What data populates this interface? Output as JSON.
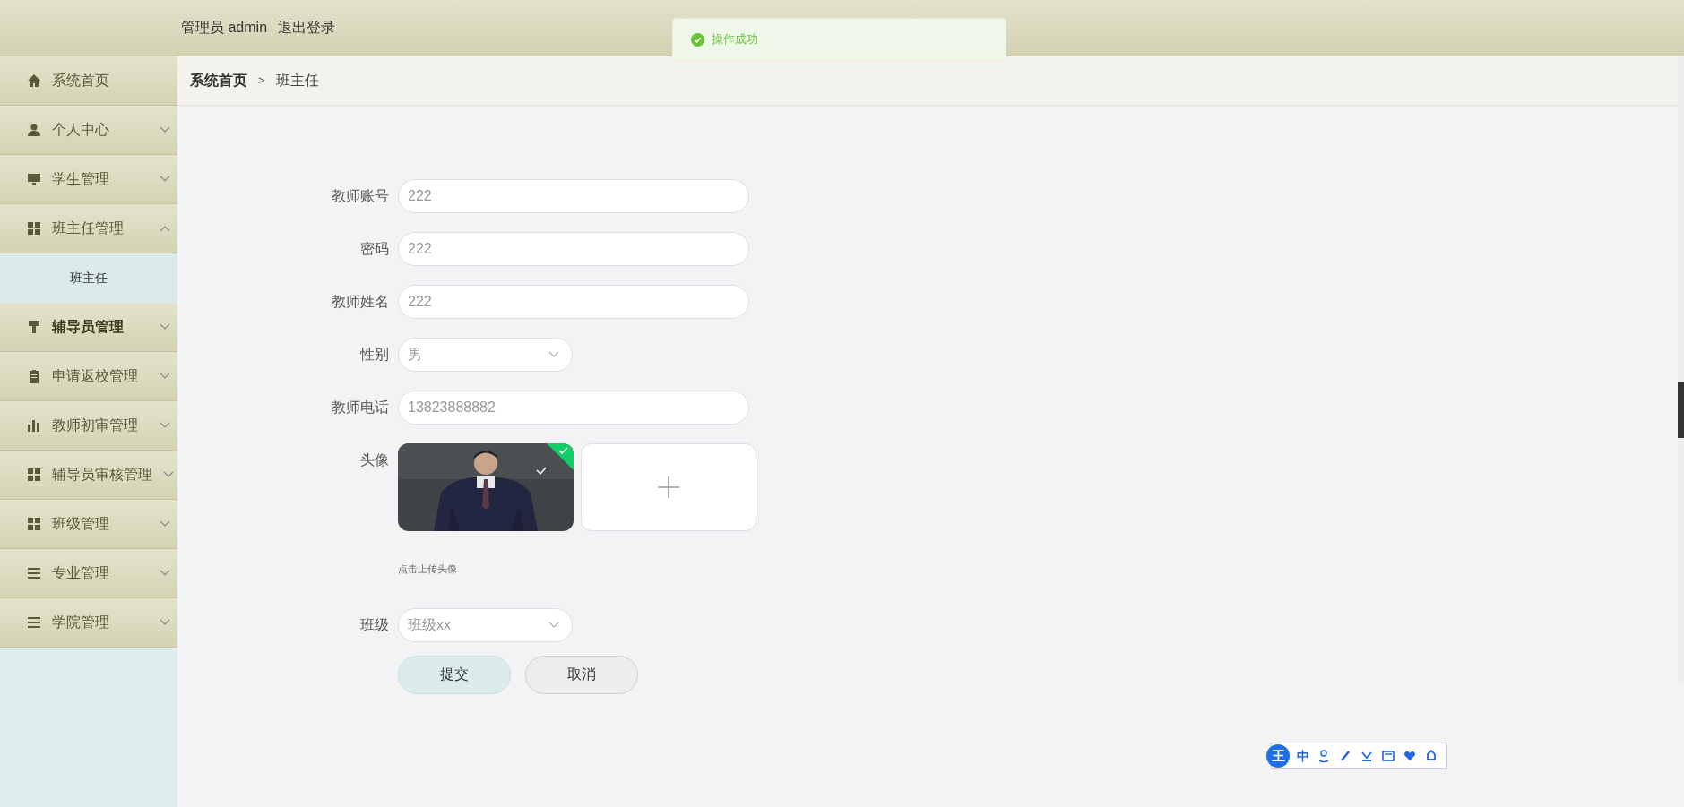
{
  "header": {
    "user_role": "管理员",
    "user_name": "admin",
    "logout": "退出登录"
  },
  "toast": {
    "kind": "success",
    "message": "操作成功"
  },
  "sidebar": {
    "items": [
      {
        "kind": "link",
        "label": "系统首页",
        "hovered": false
      },
      {
        "kind": "group",
        "label": "个人中心",
        "expanded": false,
        "hovered": false
      },
      {
        "kind": "group",
        "label": "学生管理",
        "expanded": false,
        "hovered": false
      },
      {
        "kind": "group",
        "label": "班主任管理",
        "expanded": true,
        "hovered": false,
        "children": [
          {
            "label": "班主任",
            "selected": true
          }
        ]
      },
      {
        "kind": "group",
        "label": "辅导员管理",
        "expanded": false,
        "hovered": true
      },
      {
        "kind": "group",
        "label": "申请返校管理",
        "expanded": false,
        "hovered": false
      },
      {
        "kind": "group",
        "label": "教师初审管理",
        "expanded": false,
        "hovered": false
      },
      {
        "kind": "group",
        "label": "辅导员审核管理",
        "expanded": false,
        "hovered": false
      },
      {
        "kind": "group",
        "label": "班级管理",
        "expanded": false,
        "hovered": false
      },
      {
        "kind": "group",
        "label": "专业管理",
        "expanded": false,
        "hovered": false
      },
      {
        "kind": "group",
        "label": "学院管理",
        "expanded": false,
        "hovered": false
      }
    ]
  },
  "breadcrumb": [
    {
      "label": "系统首页",
      "current": false
    },
    {
      "label": "班主任",
      "current": true
    }
  ],
  "breadcrumb_separator": ">",
  "form": {
    "fields": [
      {
        "kind": "input",
        "label": "教师账号",
        "value": "222"
      },
      {
        "kind": "input",
        "label": "密码",
        "value": "222"
      },
      {
        "kind": "input",
        "label": "教师姓名",
        "value": "222"
      },
      {
        "kind": "select",
        "label": "性别",
        "value": "男"
      },
      {
        "kind": "input",
        "label": "教师电话",
        "value": "13823888882"
      },
      {
        "kind": "upload",
        "label": "头像",
        "uploaded": true,
        "hint": "点击上传头像"
      },
      {
        "kind": "select",
        "label": "班级",
        "value": "班级xx"
      }
    ],
    "buttons": [
      {
        "kind": "primary",
        "label": "提交"
      },
      {
        "kind": "secondary",
        "label": "取消"
      }
    ]
  },
  "ime_toolbar": {
    "logo": "王",
    "mode": "中"
  }
}
